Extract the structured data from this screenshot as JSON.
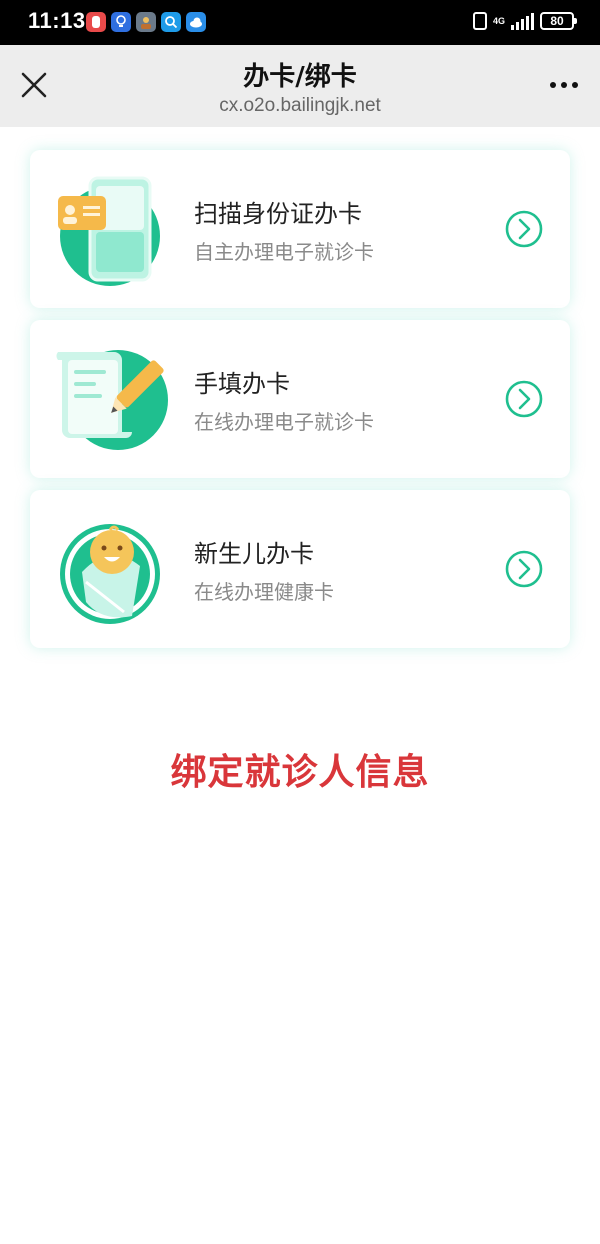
{
  "status_bar": {
    "time": "11:13",
    "network": "4G",
    "battery": "80",
    "notification_icons": [
      "app-red-icon",
      "bulb-icon",
      "avatar-icon",
      "search-app-icon",
      "cloud-icon"
    ]
  },
  "nav": {
    "title": "办卡/绑卡",
    "subtitle": "cx.o2o.bailingjk.net",
    "close_icon": "close-icon",
    "more_icon": "more-icon"
  },
  "cards": [
    {
      "title": "扫描身份证办卡",
      "subtitle": "自主办理电子就诊卡",
      "icon": "id-card-scan-icon"
    },
    {
      "title": "手填办卡",
      "subtitle": "在线办理电子就诊卡",
      "icon": "form-pen-icon"
    },
    {
      "title": "新生儿办卡",
      "subtitle": "在线办理健康卡",
      "icon": "newborn-baby-icon"
    }
  ],
  "bind_section": {
    "title": "绑定就诊人信息"
  },
  "colors": {
    "accent": "#1fbf8f",
    "highlight": "#d9363a",
    "nav_background": "#ededed",
    "status_bar": "#000000"
  }
}
